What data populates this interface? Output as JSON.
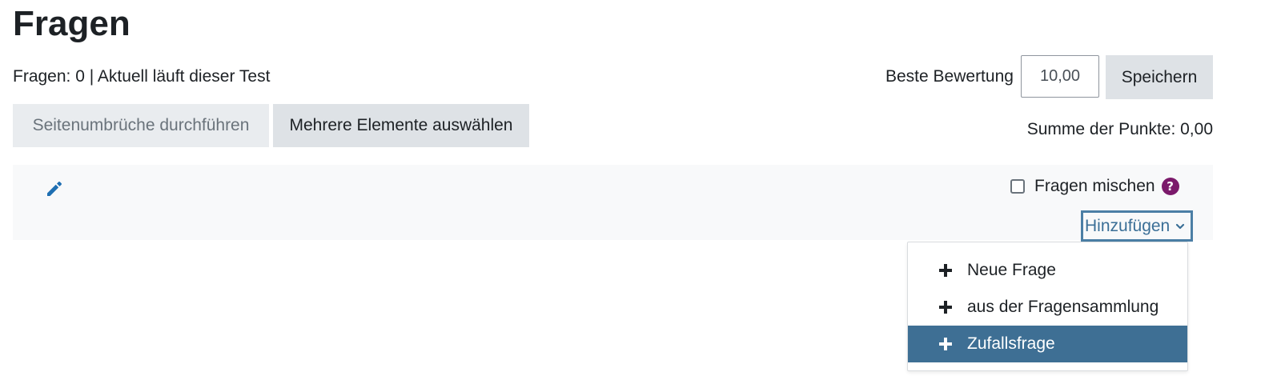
{
  "page": {
    "title": "Fragen",
    "status": "Fragen: 0 | Aktuell läuft dieser Test"
  },
  "grade": {
    "label": "Beste Bewertung",
    "value": "10,00",
    "save_label": "Speichern"
  },
  "toolbar": {
    "repaginate_label": "Seitenumbrüche durchführen",
    "select_multiple_label": "Mehrere Elemente auswählen"
  },
  "totals": {
    "sum_label": "Summe der Punkte: 0,00"
  },
  "section": {
    "shuffle_label": "Fragen mischen",
    "shuffle_checked": false,
    "add_label": "Hinzufügen"
  },
  "add_menu": {
    "items": [
      {
        "label": "Neue Frage",
        "icon": "plus-icon",
        "active": false
      },
      {
        "label": "aus der Fragensammlung",
        "icon": "plus-icon",
        "active": false
      },
      {
        "label": "Zufallsfrage",
        "icon": "plus-icon",
        "active": true
      }
    ]
  },
  "colors": {
    "accent": "#3e6f94",
    "help_icon": "#7b1a6b",
    "button_bg": "#dee2e6"
  }
}
